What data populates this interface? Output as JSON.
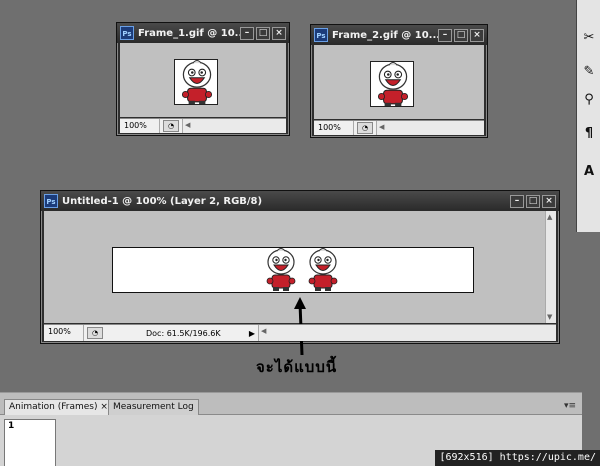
{
  "windows": {
    "frame1": {
      "title": "Frame_1.gif @ 10...",
      "zoom": "100%"
    },
    "frame2": {
      "title": "Frame_2.gif @ 10...",
      "zoom": "100%"
    },
    "untitled": {
      "title": "Untitled-1 @ 100% (Layer 2, RGB/8)",
      "zoom": "100%",
      "doc_info": "Doc: 61.5K/196.6K"
    }
  },
  "window_controls": {
    "minimize": "–",
    "maximize": "□",
    "close": "×"
  },
  "app_badge": "Ps",
  "caption": "จะได้แบบนี้",
  "animation_panel": {
    "tabs": [
      {
        "label": "Animation (Frames)",
        "close": "×"
      },
      {
        "label": "Measurement Log"
      }
    ],
    "frame_number": "1"
  },
  "watermark": "[692x516] https://upic.me/",
  "icons": [
    "photoshop-icon",
    "navigator-icon",
    "arrow-down-icon",
    "arrow-up-icon",
    "arrow-left-icon",
    "arrow-right-icon",
    "scissors-icon",
    "brush-icon",
    "pin-icon",
    "paragraph-icon",
    "character-icon",
    "pointer-arrow-icon",
    "sticker-character-icon"
  ]
}
